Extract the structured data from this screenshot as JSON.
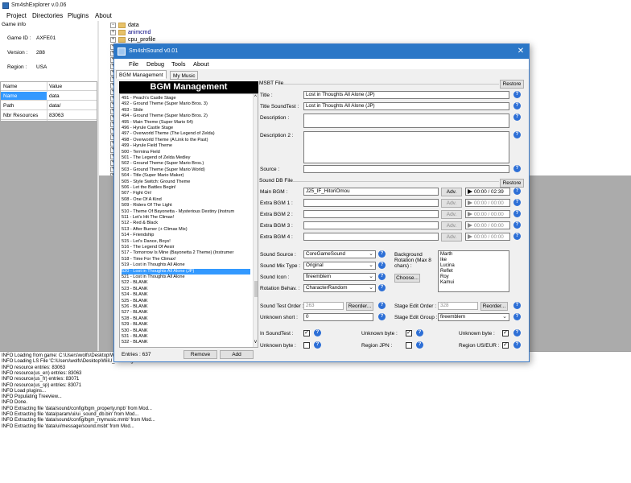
{
  "main": {
    "title": "Sm4shExplorer v.0.06",
    "menu": [
      "Project",
      "Directories",
      "Plugins",
      "About"
    ],
    "game_info": {
      "header": "Game info",
      "game_id_label": "Game ID :",
      "game_id": "AXFE01",
      "version_label": "Version :",
      "version": "288",
      "region_label": "Region :",
      "region": "USA"
    },
    "props": {
      "col_name": "Name",
      "col_value": "Value",
      "rows": [
        {
          "name": "Name",
          "value": "data"
        },
        {
          "name": "Path",
          "value": "data/"
        },
        {
          "name": "Nbr Resources",
          "value": "83063"
        }
      ]
    },
    "tree": {
      "root": "data",
      "children": [
        "animcmd",
        "cpu_profile"
      ]
    },
    "log": [
      "INFO  Loading from game: C:\\Users\\wolfs\\Desktop\\Wii",
      "INFO  Loading LS File 'C:\\Users\\wolfs\\Desktop\\WiiU_Modding\\Smash\\content\\ls'",
      "INFO  resource entries: 83063",
      "INFO  resource(us_en) entries: 83063",
      "INFO  resource(us_fr) entries: 83071",
      "INFO  resource(us_sp) entries: 83071",
      "INFO  Load plugins...",
      "INFO  Populating Treeview...",
      "INFO  Done.",
      "INFO  Extracting file 'data/sound/config/bgm_property.mpb' from Mod...",
      "INFO  Extracting file 'data/param/ui/ui_sound_db.bin' from Mod...",
      "INFO  Extracting file 'data/sound/config/bgm_mymusic.mmb' from Mod...",
      "INFO  Extracting file 'data/ui/message/sound.msbt' from Mod..."
    ]
  },
  "child": {
    "title": "Sm4shSound v0.01",
    "close": "✕",
    "menu": [
      "File",
      "Debug",
      "Tools",
      "About"
    ],
    "tabs": [
      "BGM Management",
      "My Music"
    ],
    "bgm_header": "BGM Management",
    "bgm_items": [
      "491 - Peach's Castle Stage",
      "492 - Ground Theme (Super Mario Bros. 3)",
      "493 - Slide",
      "494 - Ground Theme (Super Mario Bros. 2)",
      "495 - Main Theme (Super Mario 64)",
      "496 - Hyrule Castle Stage",
      "497 - Overworld Theme (The Legend of Zelda)",
      "498 - Overworld Theme (A Link to the Past)",
      "499 - Hyrule Field Theme",
      "500 - Termina Field",
      "501 - The Legend of Zelda Medley",
      "502 - Ground Theme (Super Mario Bros.)",
      "503 - Ground Theme (Super Mario World)",
      "504 - Title (Super Mario Maker)",
      "505 - Style Switch: Ground Theme",
      "506 - Let the Battles Begin!",
      "507 - Fight On!",
      "508 - One Of A Kind",
      "509 - Riders Of The Light",
      "510 - Theme Of Bayonetta - Mysterious Destiny (Instrum",
      "511 - Let's Hit The Climax!",
      "512 - Red & Black",
      "513 - After Burner (+ Climax Mix)",
      "514 - Friendship",
      "515 - Let's Dance, Boys!",
      "516 - The Legend Of Aesir",
      "517 - Tomorrow Is Mine (Bayonetta 2 Theme) (Instrumer",
      "518 - Time For The Climax!",
      "519 - Lost in Thoughts All Alone",
      "520 - Lost in Thoughts All Alone (JP)",
      "521 - Lost in Thoughts All Alone",
      "522 - BLANK",
      "523 - BLANK",
      "524 - BLANK",
      "525 - BLANK",
      "526 - BLANK",
      "527 - BLANK",
      "528 - BLANK",
      "529 - BLANK",
      "530 - BLANK",
      "531 - BLANK",
      "532 - BLANK"
    ],
    "selected_index": 29,
    "entries_label": "Entries : 637",
    "remove_label": "Remove",
    "add_label": "Add",
    "msbt": {
      "header": "MSBT File",
      "restore": "Restore",
      "title_label": "Title :",
      "title_value": "Lost in Thoughts All Alone (JP)",
      "title_st_label": "Title SoundTest :",
      "title_st_value": "Lost in Thoughts All Alone (JP)",
      "desc_label": "Description :",
      "desc2_label": "Description 2 :",
      "source_label": "Source :"
    },
    "sounddb": {
      "header": "Sound DB File",
      "restore": "Restore",
      "bgm_rows": [
        {
          "label": "Main BGM :",
          "value": "J25_IF_HitoriOmou",
          "time": "00:00 / 02:39",
          "enabled": true
        },
        {
          "label": "Extra BGM 1 :",
          "value": "",
          "time": "00:00 / 00:00",
          "enabled": false
        },
        {
          "label": "Extra BGM 2 :",
          "value": "",
          "time": "00:00 / 00:00",
          "enabled": false
        },
        {
          "label": "Extra BGM 3 :",
          "value": "",
          "time": "00:00 / 00:00",
          "enabled": false
        },
        {
          "label": "Extra BGM 4 :",
          "value": "",
          "time": "00:00 / 00:00",
          "enabled": false
        }
      ],
      "adv_label": "Adv.",
      "sound_source_label": "Sound Source :",
      "sound_source": "CoreGameSound",
      "sound_mix_label": "Sound Mix Type :",
      "sound_mix": "Original",
      "sound_icon_label": "Sound Icon :",
      "sound_icon": "fireemblem",
      "rotation_label": "Rotation Behav. :",
      "rotation": "CharacterRandom",
      "bg_rotation_label": "Background Rotation (Max 8 chars) :",
      "bg_rotation_items": [
        "Marth",
        "Ike",
        "Lucina",
        "Reflet",
        "Roy",
        "Kamui"
      ],
      "choose_label": "Choose...",
      "sound_test_order_label": "Sound Test Order :",
      "sound_test_order": "263",
      "reorder_label": "Reorder...",
      "stage_edit_order_label": "Stage Edit Order :",
      "stage_edit_order": "328",
      "unknown_short_label": "Unknown short :",
      "unknown_short": "0",
      "stage_edit_group_label": "Stage Edit Group :",
      "stage_edit_group": "fireemblem",
      "in_soundtest_label": "In SoundTest :",
      "unknown_byte_label": "Unknown byte :",
      "region_jpn_label": "Region JPN :",
      "region_useur_label": "Region US/EUR :"
    }
  }
}
